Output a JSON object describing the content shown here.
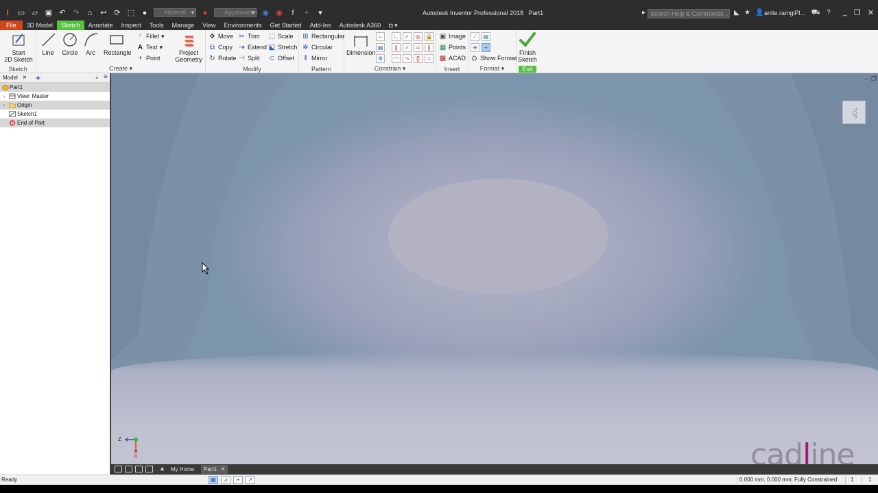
{
  "titlebar": {
    "title": "Autodesk Inventor Professional 2018",
    "doc": "Part1",
    "material_placeholder": "Material",
    "appearance_placeholder": "Appearance",
    "search_placeholder": "Search Help & Commands...",
    "user": "anite.ramgiPl..."
  },
  "tabs": [
    "File",
    "3D Model",
    "Sketch",
    "Annotate",
    "Inspect",
    "Tools",
    "Manage",
    "View",
    "Environments",
    "Get Started",
    "Add-Ins",
    "Autodesk A360"
  ],
  "active_tab": "Sketch",
  "ribbon": {
    "sketch": {
      "start_sketch_l1": "Start",
      "start_sketch_l2": "2D Sketch",
      "label": "Sketch"
    },
    "create": {
      "line": "Line",
      "circle": "Circle",
      "arc": "Arc",
      "rectangle": "Rectangle",
      "fillet": "Fillet",
      "text": "Text",
      "point": "Point",
      "project_l1": "Project",
      "project_l2": "Geometry",
      "label": "Create"
    },
    "modify": {
      "move": "Move",
      "copy": "Copy",
      "rotate": "Rotate",
      "trim": "Trim",
      "extend": "Extend",
      "split": "Split",
      "scale": "Scale",
      "stretch": "Stretch",
      "offset": "Offset",
      "label": "Modify"
    },
    "pattern": {
      "rectangular": "Rectangular",
      "circular": "Circular",
      "mirror": "Mirror",
      "label": "Pattern"
    },
    "constrain": {
      "dimension": "Dimension",
      "label": "Constrain"
    },
    "insert": {
      "image": "Image",
      "points": "Points",
      "acad": "ACAD",
      "label": "Insert"
    },
    "format": {
      "show_format": "Show Format",
      "label": "Format"
    },
    "exit": {
      "finish_l1": "Finish",
      "finish_l2": "Sketch",
      "label": "Exit"
    }
  },
  "browser": {
    "tab": "Model",
    "tree": [
      {
        "label": "Part1",
        "icon": "part-icon",
        "selected": true,
        "indent": 0
      },
      {
        "label": "View: Master",
        "icon": "view-icon",
        "selected": false,
        "indent": 1
      },
      {
        "label": "Origin",
        "icon": "folder-icon",
        "selected": true,
        "indent": 1
      },
      {
        "label": "Sketch1",
        "icon": "sketch-icon",
        "selected": false,
        "indent": 1
      },
      {
        "label": "End of Part",
        "icon": "end-of-part-icon",
        "selected": true,
        "indent": 1
      }
    ]
  },
  "viewport": {
    "viewcube_face": "TOP",
    "triad": {
      "z": "Z",
      "x": "X"
    },
    "watermark": {
      "part1": "cad",
      "part2": "l",
      "part3": "ine"
    }
  },
  "doc_tabs": {
    "home": "My Home",
    "part": "Part1"
  },
  "status": {
    "ready": "Ready",
    "coords": "0.000 mm, 0.000 mm",
    "constraint": "Fully Constrained",
    "count1": "1",
    "count2": "1"
  },
  "colors": {
    "accent_green": "#56c13d",
    "file_tab": "#d2461d",
    "brand_magenta": "#a31a6a"
  }
}
